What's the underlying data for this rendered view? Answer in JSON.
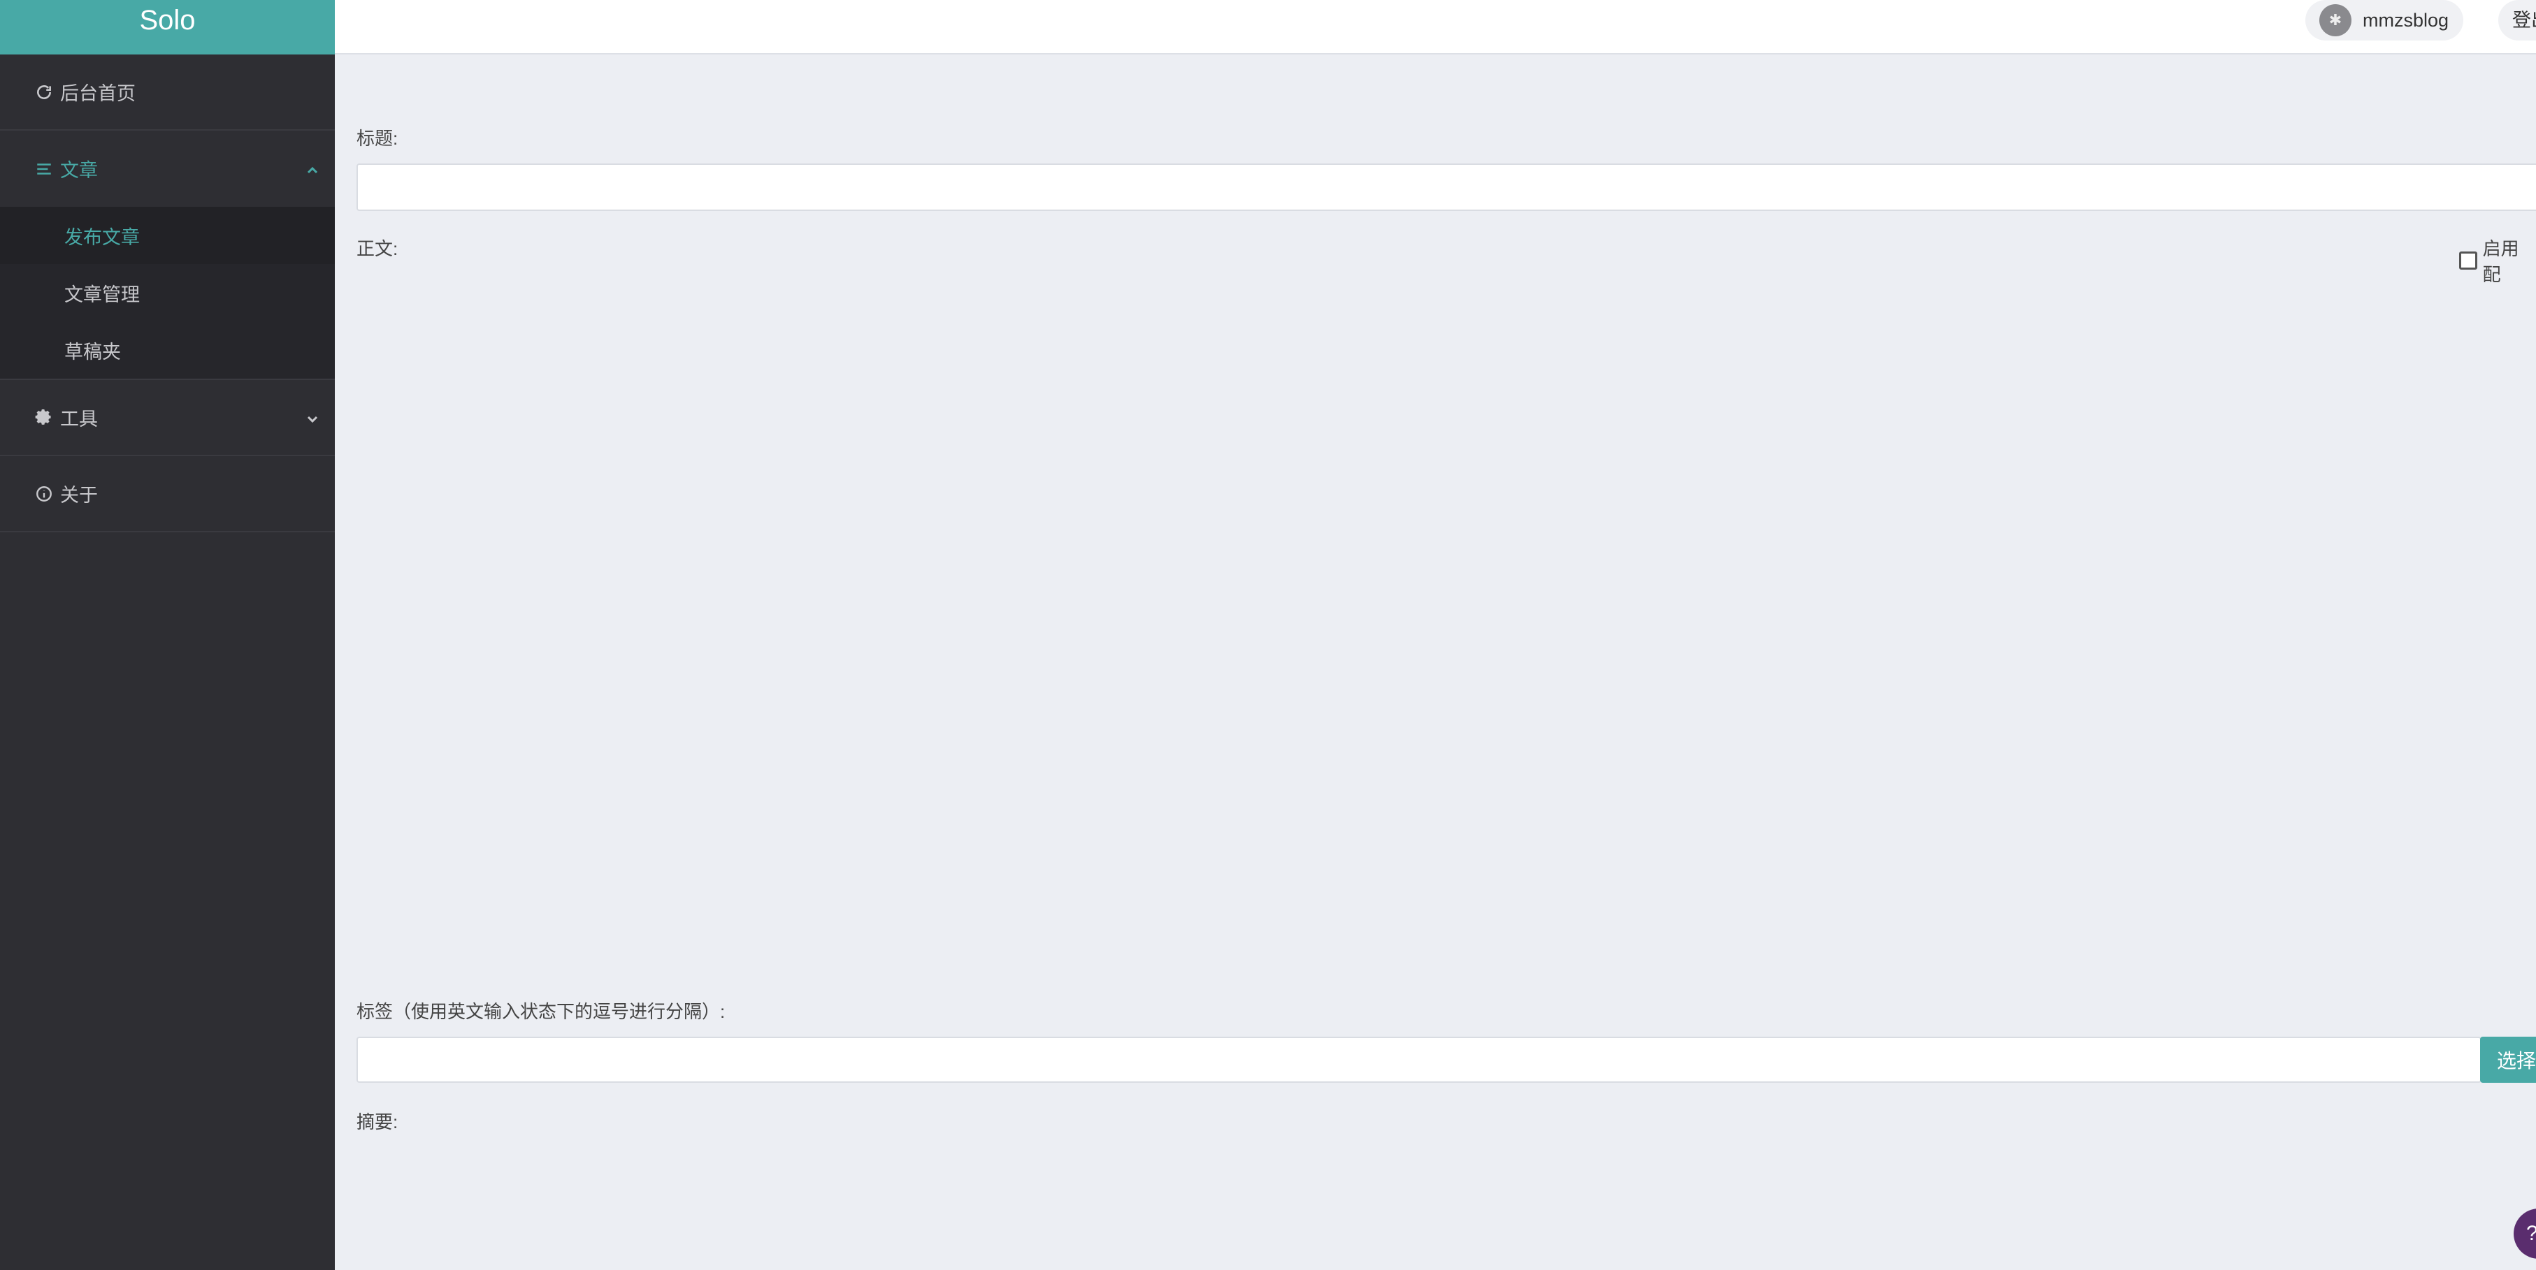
{
  "sidebar": {
    "brand": "Solo",
    "home": {
      "label": "后台首页",
      "icon": "refresh-icon"
    },
    "articles": {
      "label": "文章",
      "icon": "list-icon",
      "expanded": true,
      "items": [
        {
          "label": "发布文章",
          "active": true
        },
        {
          "label": "文章管理",
          "active": false
        },
        {
          "label": "草稿夹",
          "active": false
        }
      ]
    },
    "tools": {
      "label": "工具",
      "icon": "gear-icon"
    },
    "about": {
      "label": "关于",
      "icon": "info-icon"
    }
  },
  "header": {
    "username": "mmzsblog",
    "logout_label": "登出"
  },
  "form": {
    "title_label": "标题:",
    "title_value": "",
    "content_label": "正文:",
    "checkbox_label": "启用配",
    "tags_label": "标签（使用英文输入状态下的逗号进行分隔）:",
    "tags_value": "",
    "select_button": "选择",
    "abstract_label": "摘要:"
  },
  "colors": {
    "accent": "#48a9a6",
    "sidebar_bg": "#2e2e33",
    "page_bg": "#eceef3"
  }
}
